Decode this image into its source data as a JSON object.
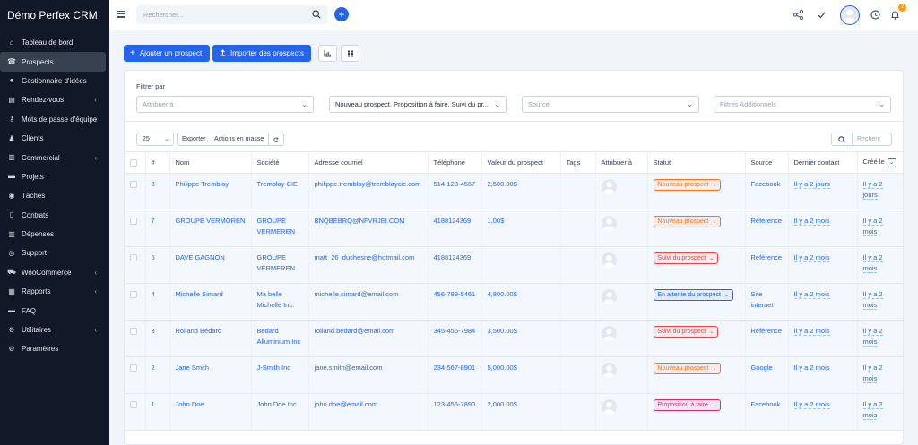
{
  "app": {
    "brand": "Démo Perfex CRM"
  },
  "sidebar": {
    "items": [
      {
        "label": "Tableau de bord",
        "icon": "home-icon",
        "active": false,
        "chevron": false
      },
      {
        "label": "Prospects",
        "icon": "tty-icon",
        "active": true,
        "chevron": false
      },
      {
        "label": "Gestionnaire d'idées",
        "icon": "lightbulb-icon",
        "active": false,
        "chevron": false
      },
      {
        "label": "Rendez-vous",
        "icon": "calendar-icon",
        "active": false,
        "chevron": true
      },
      {
        "label": "Mots de passe d'équipe",
        "icon": "key-icon",
        "active": false,
        "chevron": true
      },
      {
        "label": "Clients",
        "icon": "user-icon",
        "active": false,
        "chevron": false
      },
      {
        "label": "Commercial",
        "icon": "receipt-icon",
        "active": false,
        "chevron": true
      },
      {
        "label": "Projets",
        "icon": "folder-icon",
        "active": false,
        "chevron": false
      },
      {
        "label": "Tâches",
        "icon": "check-circle-icon",
        "active": false,
        "chevron": false
      },
      {
        "label": "Contrats",
        "icon": "file-icon",
        "active": false,
        "chevron": false
      },
      {
        "label": "Dépenses",
        "icon": "receipt-icon",
        "active": false,
        "chevron": false
      },
      {
        "label": "Support",
        "icon": "lifebuoy-icon",
        "active": false,
        "chevron": false
      },
      {
        "label": "WooCommerce",
        "icon": "cart-icon",
        "active": false,
        "chevron": true
      },
      {
        "label": "Rapports",
        "icon": "chart-icon",
        "active": false,
        "chevron": true
      },
      {
        "label": "FAQ",
        "icon": "folder-icon",
        "active": false,
        "chevron": false
      },
      {
        "label": "Utilitaires",
        "icon": "cogs-icon",
        "active": false,
        "chevron": true
      },
      {
        "label": "Paramètres",
        "icon": "gear-icon",
        "active": false,
        "chevron": false
      }
    ]
  },
  "topbar": {
    "search_placeholder": "Rechercher...",
    "notification_count": "2"
  },
  "actions": {
    "add_label": "Ajouter un prospect",
    "import_label": "Importer des prospects"
  },
  "filters": {
    "title": "Filtrer par",
    "assigned_placeholder": "Attribuer à",
    "status_value": "Nouveau prospect, Proposition à faire, Suivi du pr...",
    "source_placeholder": "Source",
    "extra_placeholder": "Filtres Additionnels"
  },
  "table_tools": {
    "page_length": "25",
    "export_label": "Exporter",
    "bulk_label": "Actions en masse",
    "search_placeholder": "Recherc"
  },
  "table": {
    "headers": [
      "#",
      "Nom",
      "Société",
      "Adresse courriel",
      "Téléphone",
      "Valeur du prospect",
      "Tags",
      "Attribuer à",
      "Statut",
      "Source",
      "Dernier contact",
      "Créé le"
    ],
    "rows": [
      {
        "id": "8",
        "name": "Philippe Tremblay",
        "company": "Tremblay CIE",
        "email": "philippe.tremblay@tremblaycie.com",
        "phone": "514-123-4567",
        "value": "2,500.00$",
        "status": "Nouveau prospect",
        "status_color": "#f97316",
        "source": "Facebook",
        "last": "Il y a 2 jours",
        "created": "Il y a 2 jours"
      },
      {
        "id": "7",
        "name": "GROUPE VERMOREN",
        "company": "GROUPE VERMEREN",
        "email": "BNQBEBRQ@NFVRJEI.COM",
        "phone": "4188124369",
        "value": "1.00$",
        "status": "Nouveau prospect",
        "status_color": "#f97316",
        "source": "Référence",
        "last": "Il y a 2 mois",
        "created": "Il y a 2 mois"
      },
      {
        "id": "6",
        "name": "DAVE GAGNON",
        "company": "GROUPE VERMEREN",
        "email": "matt_26_duchesne@hotmail.com",
        "phone": "4188124369",
        "value": "",
        "status": "Suivi du prospect",
        "status_color": "#ef4444",
        "source": "Référence",
        "last": "Il y a 2 mois",
        "created": "Il y a 2 mois"
      },
      {
        "id": "4",
        "name": "Michelle Simard",
        "company": "Ma belle Michelle Inc.",
        "email": "michelle.simard@email.com",
        "phone": "456-789-5461",
        "value": "4,800.00$",
        "status": "En attente du prospect",
        "status_color": "#2563eb",
        "source": "Site internet",
        "last": "Il y a 2 mois",
        "created": "Il y a 2 mois"
      },
      {
        "id": "3",
        "name": "Rolland Bédard",
        "company": "Bedard Alluminium Inc",
        "email": "rolland.bedard@email.com",
        "phone": "345-456-7984",
        "value": "3,500.00$",
        "status": "Suivi du prospect",
        "status_color": "#ef4444",
        "source": "Référence",
        "last": "Il y a 2 mois",
        "created": "Il y a 2 mois"
      },
      {
        "id": "2",
        "name": "Jane Smith",
        "company": "J-Smith Inc",
        "email": "jane.smith@email.com",
        "phone": "234-567-8901",
        "value": "5,000.00$",
        "status": "Nouveau prospect",
        "status_color": "#f97316",
        "source": "Google",
        "last": "Il y a 2 mois",
        "created": "Il y a 2 mois"
      },
      {
        "id": "1",
        "name": "John Doe",
        "company": "John Doe Inc",
        "email": "john.doe@email.com",
        "phone": "123-456-7890",
        "value": "2,000.00$",
        "status": "Proposition à faire",
        "status_color": "#db2777",
        "source": "Facebook",
        "last": "Il y a 2 mois",
        "created": "Il y a 2 mois"
      }
    ]
  }
}
